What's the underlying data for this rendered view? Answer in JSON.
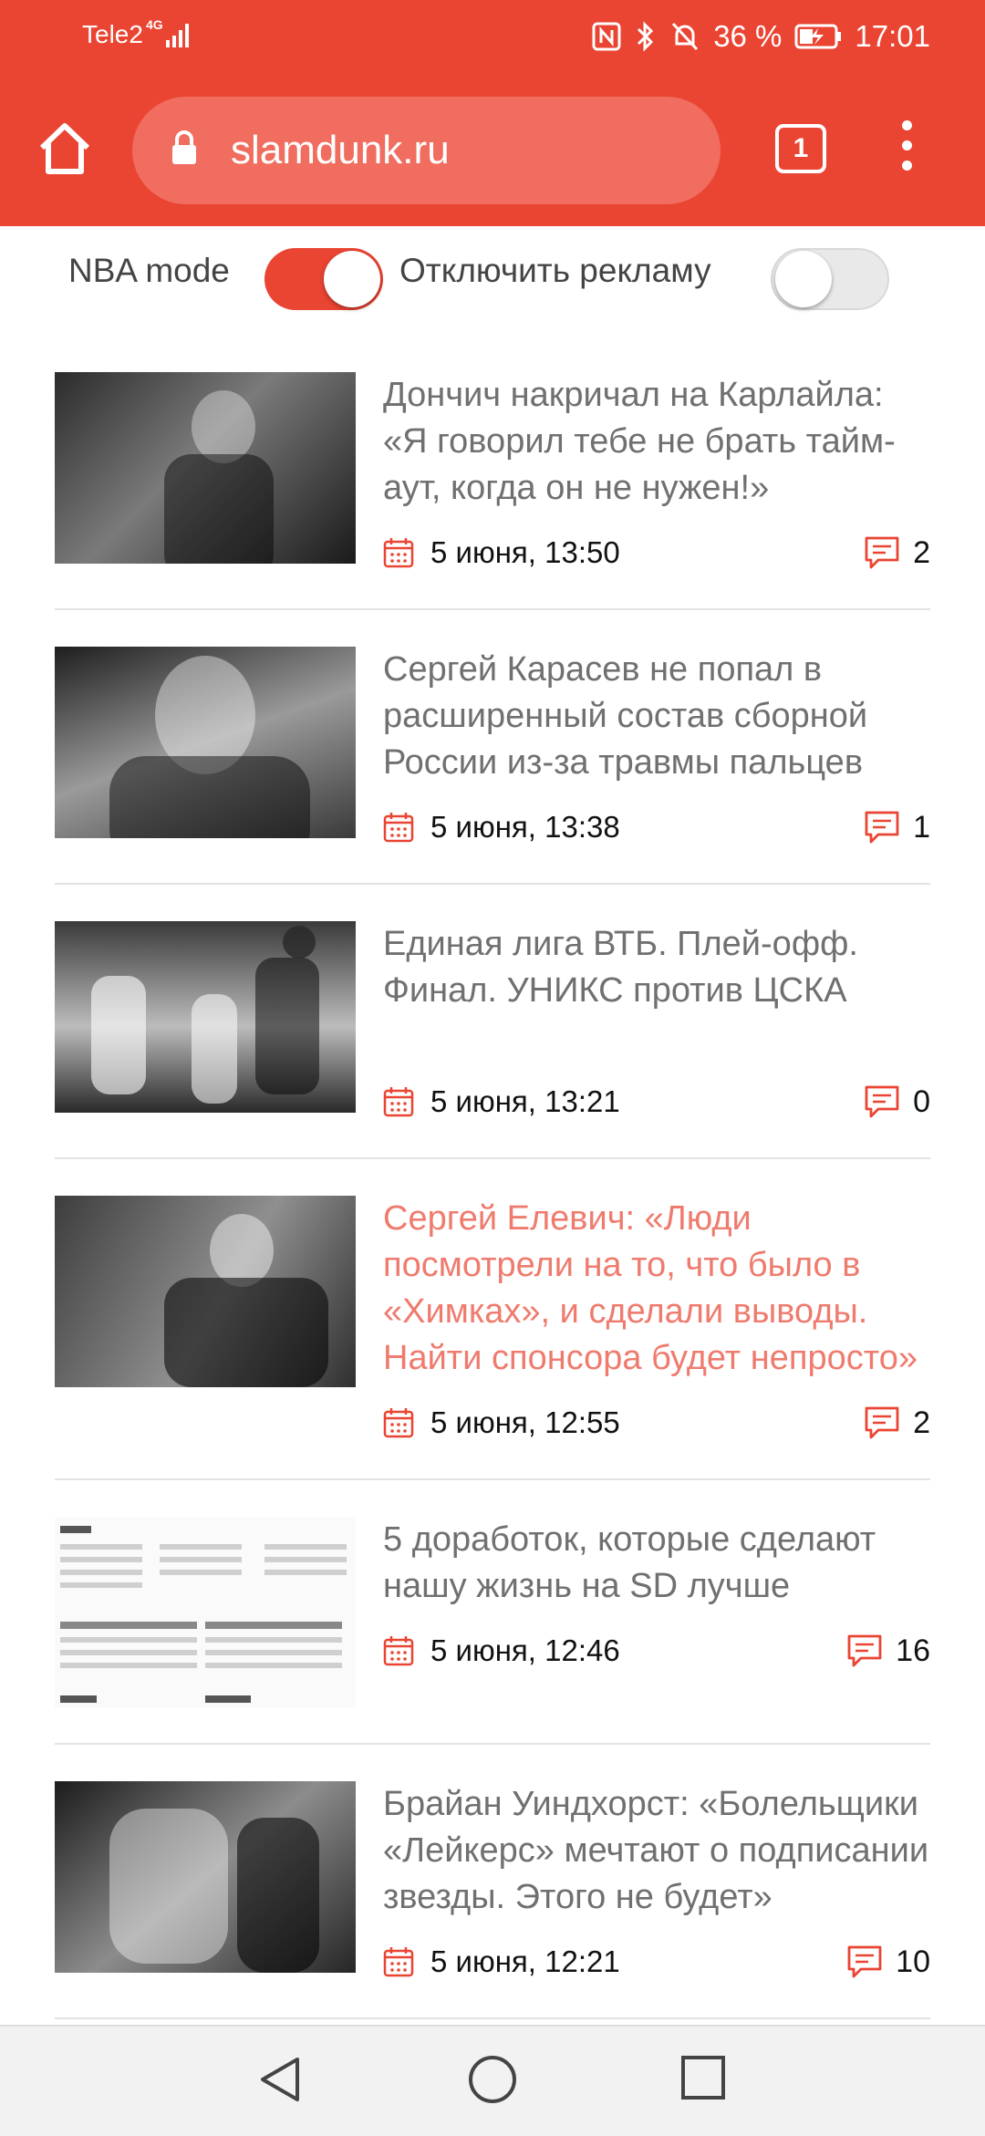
{
  "status": {
    "carrier": "Tele2",
    "network": "4G",
    "battery": "36 %",
    "time": "17:01",
    "icons": [
      "signal-icon",
      "nfc-icon",
      "bluetooth-icon",
      "mute-icon",
      "battery-charging-icon"
    ]
  },
  "browser": {
    "url": "slamdunk.ru",
    "tab_count": "1",
    "icons": [
      "home-icon",
      "lock-icon",
      "tabs-icon",
      "more-vert-icon"
    ]
  },
  "toggles": {
    "nba_mode": {
      "label": "NBA mode",
      "on": true
    },
    "ads": {
      "label": "Отключить рекламу",
      "on": false
    }
  },
  "colors": {
    "accent": "#ea4432",
    "headline": "#707070",
    "visited_headline": "#ef7b6e"
  },
  "news": [
    {
      "title": "Дончич накричал на Карлайла: «Я говорил тебе не брать тайм-аут, когда он не нужен!»",
      "date": "5 июня, 13:50",
      "comments": "2",
      "visited": false
    },
    {
      "title": "Сергей Карасев не попал в расширенный состав сборной России из-за травмы пальцев",
      "date": "5 июня, 13:38",
      "comments": "1",
      "visited": false
    },
    {
      "title": "Единая лига ВТБ. Плей-офф. Финал. УНИКС против ЦСКА",
      "date": "5 июня, 13:21",
      "comments": "0",
      "visited": false
    },
    {
      "title": "Сергей Елевич: «Люди посмотрели на то, что было в «Химках», и сделали выводы. Найти спонсора будет непросто»",
      "date": "5 июня, 12:55",
      "comments": "2",
      "visited": true
    },
    {
      "title": "5 доработок, которые сделают нашу жизнь на SD лучше",
      "date": "5 июня, 12:46",
      "comments": "16",
      "visited": false
    },
    {
      "title": "Брайан Уиндхорст: «Болельщики «Лейкерс» мечтают о подписании звезды. Этого не будет»",
      "date": "5 июня, 12:21",
      "comments": "10",
      "visited": false
    }
  ],
  "nav": {
    "icons": [
      "back-icon",
      "home-circle-icon",
      "recents-icon"
    ]
  }
}
